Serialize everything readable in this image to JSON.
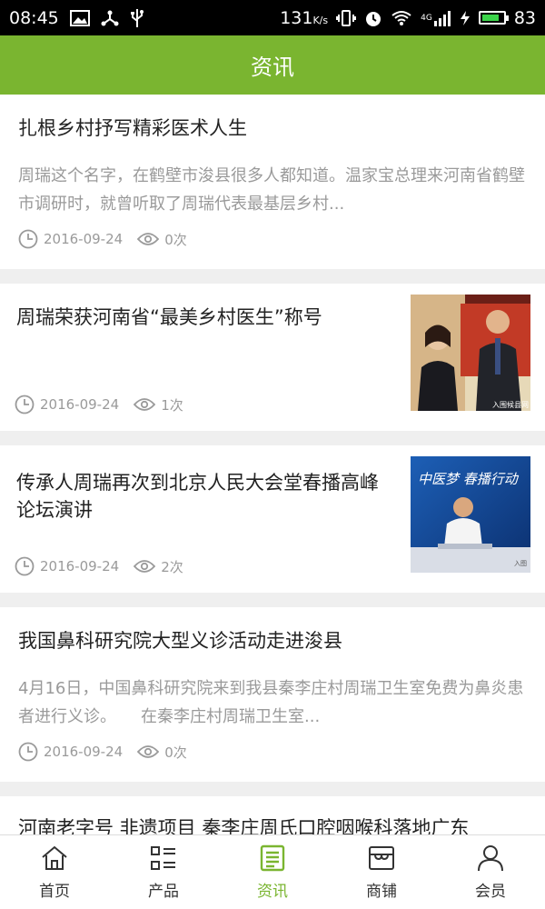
{
  "status_bar": {
    "time": "08:45",
    "net_speed": "131",
    "net_unit": "K/s",
    "network_type": "4G",
    "battery": "83"
  },
  "header": {
    "title": "资讯"
  },
  "articles": [
    {
      "title": "扎根乡村抒写精彩医术人生",
      "summary": "周瑞这个名字，在鹤壁市浚县很多人都知道。温家宝总理来河南省鹤壁市调研时，就曾听取了周瑞代表最基层乡村...",
      "date": "2016-09-24",
      "views": "0次"
    },
    {
      "title": "周瑞荣获河南省“最美乡村医生”称号",
      "date": "2016-09-24",
      "views": "1次",
      "image_watermark": "入围候县网"
    },
    {
      "title": "传承人周瑞再次到北京人民大会堂春播高峰论坛演讲",
      "date": "2016-09-24",
      "views": "2次",
      "image_banner": "中医梦 春播行动"
    },
    {
      "title": "我国鼻科研究院大型义诊活动走进浚县",
      "summary": "4月16日，中国鼻科研究院来到我县秦李庄村周瑞卫生室免费为鼻炎患者进行义诊。　　在秦李庄村周瑞卫生室...",
      "date": "2016-09-24",
      "views": "0次"
    },
    {
      "title": "河南老字号 非遗项目 秦李庄周氏口腔咽喉科落地广东"
    }
  ],
  "bottom_nav": [
    {
      "label": "首页",
      "icon": "home-icon"
    },
    {
      "label": "产品",
      "icon": "grid-list-icon"
    },
    {
      "label": "资讯",
      "icon": "news-icon",
      "active": true
    },
    {
      "label": "商铺",
      "icon": "shop-icon"
    },
    {
      "label": "会员",
      "icon": "user-icon"
    }
  ],
  "colors": {
    "accent": "#7ab530",
    "meta_text": "#9a9a9a",
    "background": "#efefef"
  }
}
